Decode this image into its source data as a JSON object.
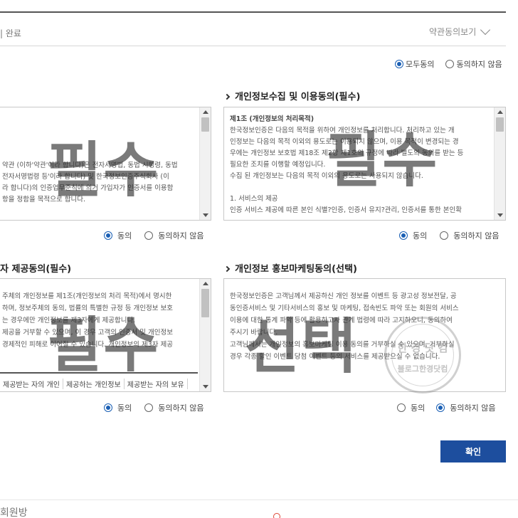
{
  "header": {
    "step_label": "| 완료",
    "terms_toggle": "약관동의보기"
  },
  "agree_all": {
    "agree_label": "모두동의",
    "disagree_label": "동의하지 않음"
  },
  "sections": {
    "terms": {
      "lines": [
        "약관 (이하'약관'이라 합니다)은 전자서명법, 동법 시행령, 동법",
        "전자서명법령 등'이라 합니다) 및 한국정보인증주식회사 (이",
        "라 합니다)의 인증업무준칙에 의거 가입자가 인증서를 이용함",
        "항을 정함을 목적으로 합니다."
      ],
      "agree_label": "동의",
      "disagree_label": "동의하지 않음",
      "watermark": "필수"
    },
    "privacy_collect": {
      "title": "개인정보수집 및 이용동의(필수)",
      "heading": "제1조 (개인정보의 처리목적)",
      "lines": [
        "한국정보인증은 다음의 목적을 위하여 개인정보를 처리합니다. 처리하고 있는 개",
        "인정보는 다음의 목적 이외의 용도로는 이용되지 않으며, 이용 목적이 변경되는 경",
        "우에는 개인정보 보호법 제18조 제2항 제1호의 규정에 따라 별도의 동의를 받는 등",
        "필요한 조치를 이행할 예정입니다.",
        "수집 된 개인정보는 다음의 목적 이외의 용도로는 사용되지 않습니다."
      ],
      "item1": "1. 서비스의 제공",
      "item1_detail": "인증 서비스 제공에 따른 본인 식별?인증, 인증서 유지?관리, 인증서를 통한 본인확",
      "agree_label": "동의",
      "disagree_label": "동의하지 않음",
      "watermark": "필수"
    },
    "third_party": {
      "title": "자 제공동의(필수)",
      "lines": [
        "주체의 개인정보를 제1조(개인정보의 처리 목적)에서 명시한",
        "하며, 정보주체의 동의, 법률의 특별한 규정 등 개인정보 보호",
        "는 경우에만 개인정보를 제3자에게 제공합니다.",
        "제공을 거부할 수 있으며, 이 경우 고객의 인증서 및 개인정보",
        "경제적인 피해로 이어질 수 있습니다. 개인정보의 제3자 제공"
      ],
      "table_headers": [
        "제공받는 자의 개인",
        "제공하는 개인정보",
        "제공받는 자의 보유"
      ],
      "agree_label": "동의",
      "disagree_label": "동의하지 않음",
      "watermark": "필수"
    },
    "marketing": {
      "title": "개인정보 홍보마케팅동의(선택)",
      "lines": [
        "한국정보인증은 고객님께서 제공하신 개인 정보를 이벤트 등 광고성 정보전달, 공",
        "동인증서비스 및 기타서비스의 홍보 및 마케팅, 접속빈도 파악 또는 회원의 서비스",
        "이용에 대한 통계 파악 등에 활용하고자 관계 법령에 따라 고지하오니, 동의하여",
        "주시기 바랍니다.",
        "고객님께서는 개인정보의 홍보마케팅 이용 동의를 거부하실 수 있으며, 거부하실",
        "경우 각종 할인 이벤트 당첨 이벤트 등의 서비스를 제공받으실 수 없습니다."
      ],
      "agree_label": "동의",
      "disagree_label": "동의하지 않음",
      "watermark": "선택",
      "selected": "disagree"
    }
  },
  "stamp": {
    "top": "한 경 닷 컴",
    "bottom": "블로그한경닷컴"
  },
  "confirm_label": "확인",
  "footer_fragment": "회원방"
}
